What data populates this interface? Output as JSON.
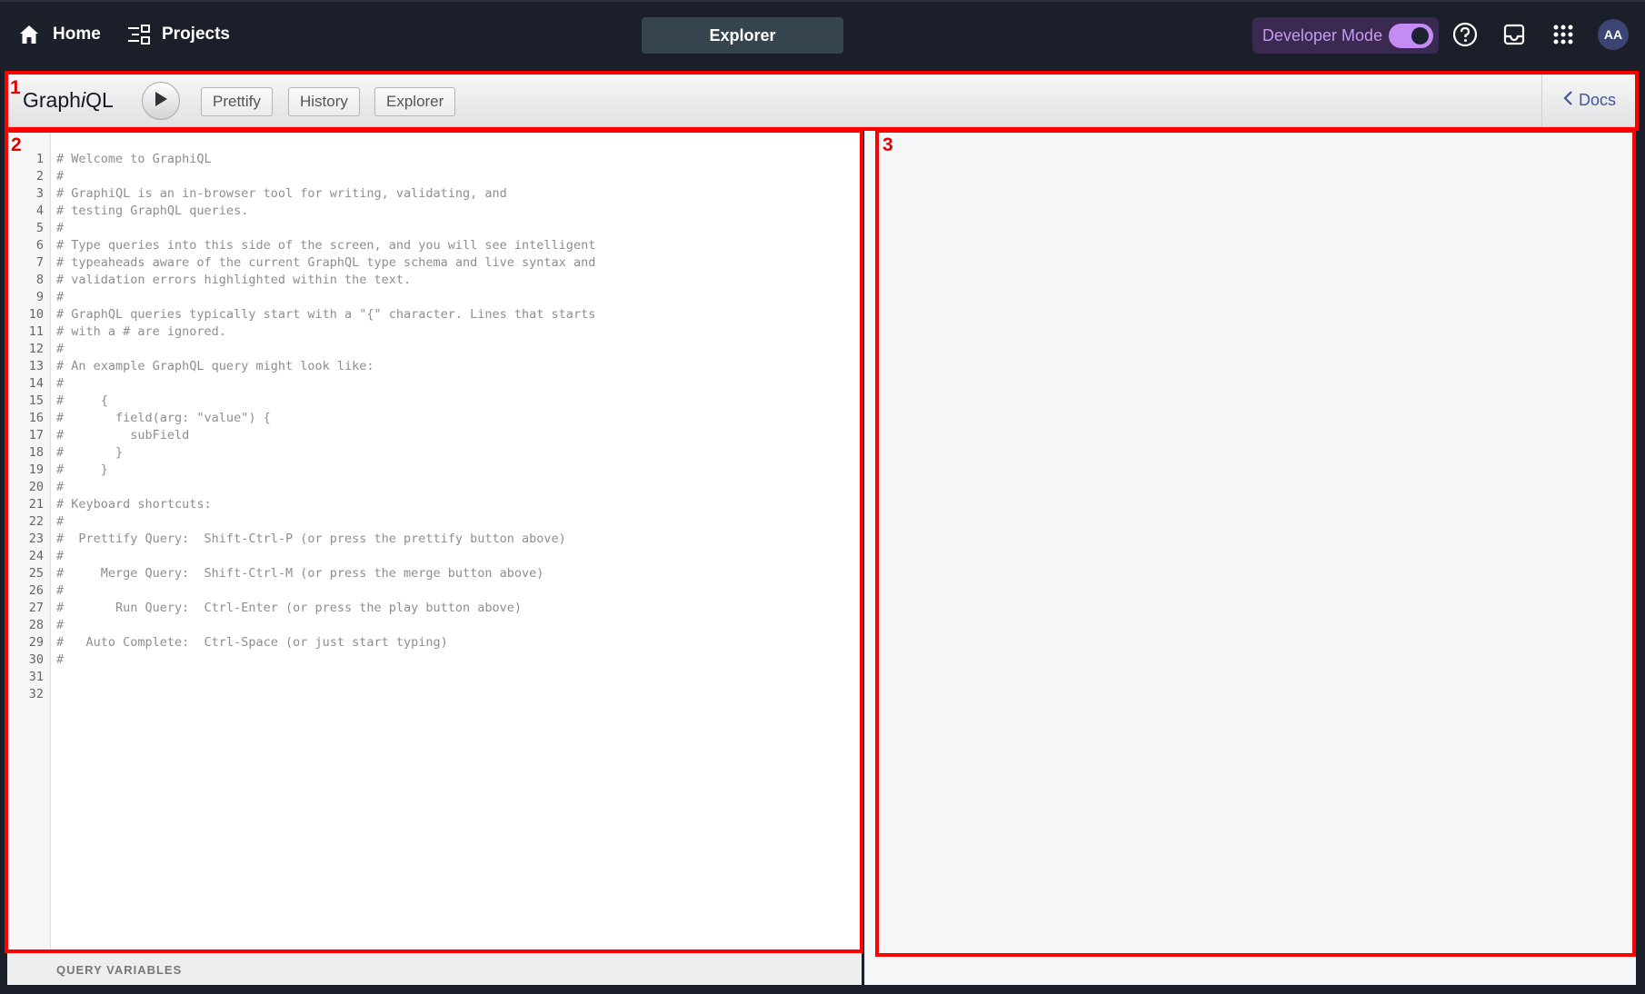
{
  "topnav": {
    "home_label": "Home",
    "projects_label": "Projects",
    "explorer_tab": "Explorer",
    "developer_mode_label": "Developer Mode",
    "developer_mode_on": true,
    "avatar_initials": "AA"
  },
  "toolbar": {
    "logo_prefix": "Graph",
    "logo_italic": "i",
    "logo_suffix": "QL",
    "prettify_label": "Prettify",
    "history_label": "History",
    "explorer_label": "Explorer",
    "docs_label": "Docs"
  },
  "editor": {
    "lines": [
      "# Welcome to GraphiQL",
      "#",
      "# GraphiQL is an in-browser tool for writing, validating, and",
      "# testing GraphQL queries.",
      "#",
      "# Type queries into this side of the screen, and you will see intelligent",
      "# typeaheads aware of the current GraphQL type schema and live syntax and",
      "# validation errors highlighted within the text.",
      "#",
      "# GraphQL queries typically start with a \"{\" character. Lines that starts",
      "# with a # are ignored.",
      "#",
      "# An example GraphQL query might look like:",
      "#",
      "#     {",
      "#       field(arg: \"value\") {",
      "#         subField",
      "#       }",
      "#     }",
      "#",
      "# Keyboard shortcuts:",
      "#",
      "#  Prettify Query:  Shift-Ctrl-P (or press the prettify button above)",
      "#",
      "#     Merge Query:  Shift-Ctrl-M (or press the merge button above)",
      "#",
      "#       Run Query:  Ctrl-Enter (or press the play button above)",
      "#",
      "#   Auto Complete:  Ctrl-Space (or just start typing)",
      "#",
      "",
      ""
    ]
  },
  "query_variables_label": "QUERY VARIABLES",
  "annotations": [
    "1",
    "2",
    "3"
  ],
  "colors": {
    "annotation": "#ff0000",
    "nav_bg": "#1b1f2a",
    "developer_mode": "#c48cf2",
    "docs_link": "#3b5998"
  }
}
